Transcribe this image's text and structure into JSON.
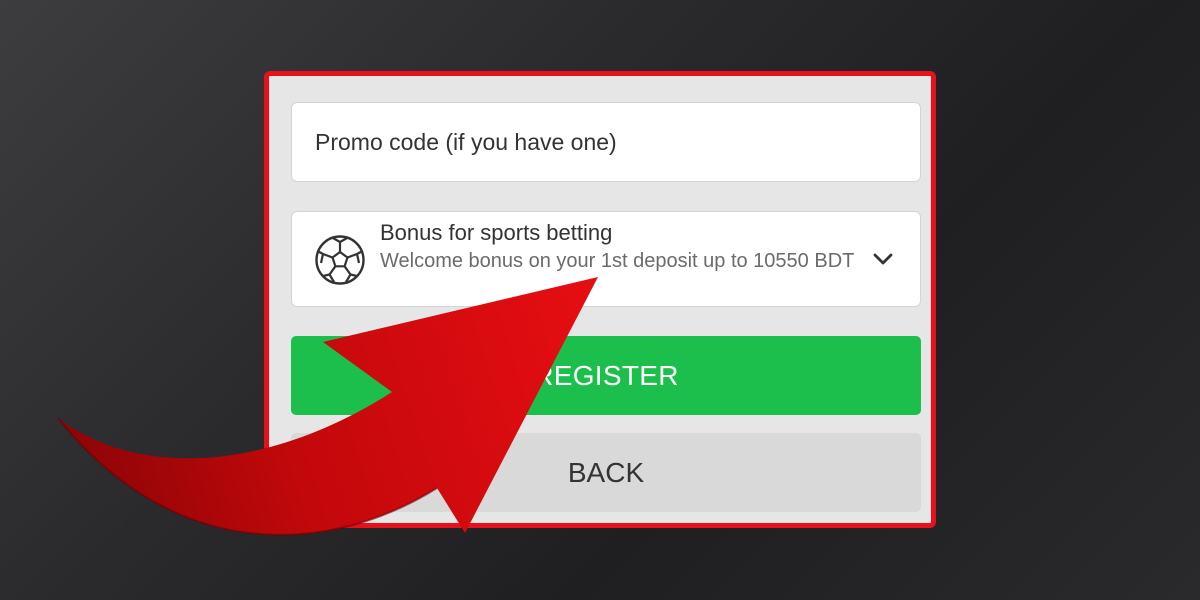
{
  "form": {
    "promo_placeholder": "Promo code (if you have one)",
    "bonus": {
      "title": "Bonus for sports betting",
      "description": "Welcome bonus on your 1st deposit up to 10550 BDT",
      "icon": "soccer-ball-icon"
    },
    "register_label": "REGISTER",
    "back_label": "BACK"
  },
  "colors": {
    "panel_border": "#e8101a",
    "register_bg": "#1cbf4c",
    "back_bg": "#d9d9d9",
    "arrow": "#c8080c"
  },
  "overlay": {
    "icon": "red-curved-arrow"
  }
}
